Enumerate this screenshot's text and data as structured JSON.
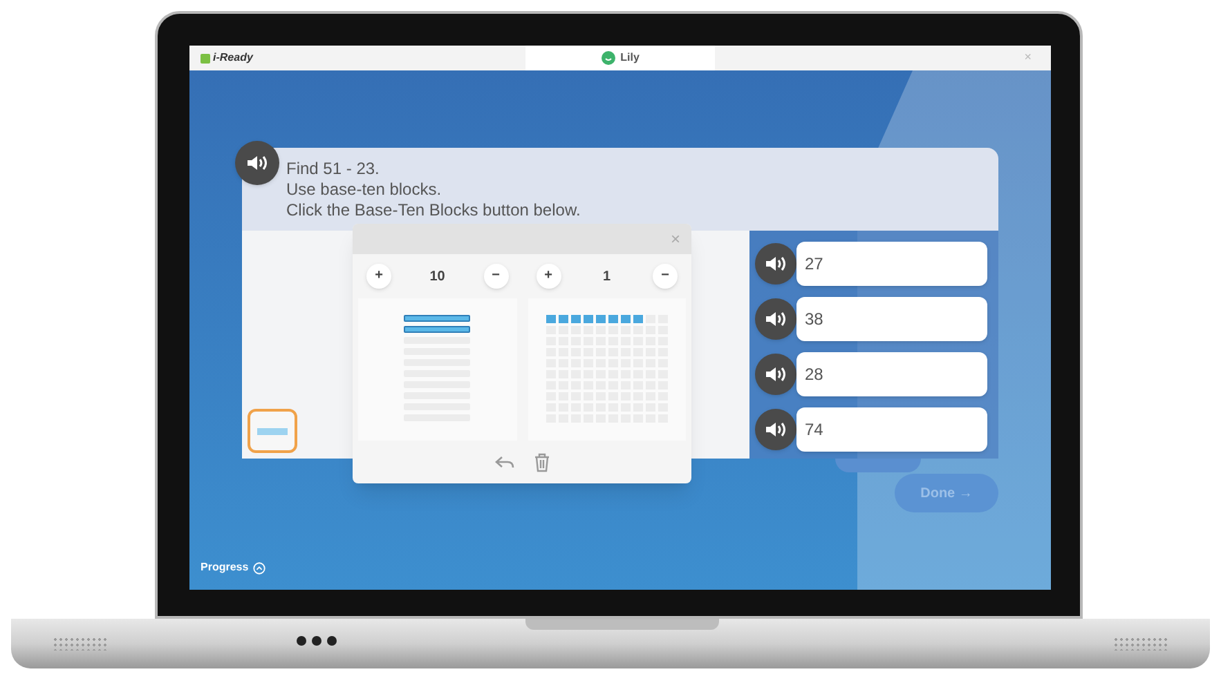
{
  "top_bar": {
    "logo": "i-Ready",
    "user": "Lily",
    "close": "×"
  },
  "question": {
    "lines": [
      "Find 51 - 23.",
      "Use base-ten blocks.",
      "Click the Base-Ten Blocks button below."
    ]
  },
  "blocks_dialog": {
    "close": "×",
    "mats": [
      {
        "plus": "+",
        "count": "10",
        "minus": "−",
        "kind": "tens",
        "rods": [
          {
            "filled": true
          },
          {
            "filled": true
          },
          {
            "filled": false
          },
          {
            "filled": false
          },
          {
            "filled": false
          },
          {
            "filled": false
          },
          {
            "filled": false
          },
          {
            "filled": false
          },
          {
            "filled": false
          },
          {
            "filled": false
          }
        ]
      },
      {
        "plus": "+",
        "count": "1",
        "minus": "−",
        "kind": "ones",
        "rows": [
          {
            "level": 0.8
          },
          {
            "level": 0
          },
          {
            "level": 0
          },
          {
            "level": 0
          },
          {
            "level": 0
          },
          {
            "level": 0
          },
          {
            "level": 0
          },
          {
            "level": 0
          },
          {
            "level": 0
          },
          {
            "level": 0
          }
        ]
      }
    ]
  },
  "answers": [
    {
      "text": "27"
    },
    {
      "text": "38"
    },
    {
      "text": "28"
    },
    {
      "text": "74"
    }
  ],
  "done_button": {
    "label": "Done →"
  },
  "footer": {
    "progress": "Progress"
  }
}
